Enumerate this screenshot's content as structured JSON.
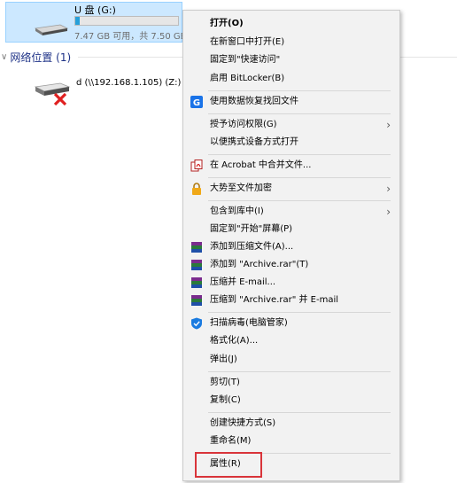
{
  "drive": {
    "name": "U 盘 (G:)",
    "free_text": "7.47 GB 可用，共 7.50 GB",
    "used_fraction": 0.04
  },
  "network_section": {
    "label": "网络位置 (1)"
  },
  "network_drive": {
    "name": "d (\\\\192.168.1.105) (Z:)"
  },
  "menu": {
    "open": "打开(O)",
    "open_new_window": "在新窗口中打开(E)",
    "pin_quick_access": "固定到\"快速访问\"",
    "bitlocker": "启用 BitLocker(B)",
    "data_recovery": "使用数据恢复找回文件",
    "grant_access": "授予访问权限(G)",
    "portable_open": "以便携式设备方式打开",
    "acrobat_merge": "在 Acrobat 中合并文件...",
    "encrypt": "大势至文件加密",
    "include_library": "包含到库中(I)",
    "pin_start": "固定到\"开始\"屏幕(P)",
    "add_archive": "添加到压缩文件(A)...",
    "add_archive_rar": "添加到 \"Archive.rar\"(T)",
    "compress_email": "压缩并 E-mail...",
    "compress_rar_email": "压缩到 \"Archive.rar\" 并 E-mail",
    "scan_virus": "扫描病毒(电脑管家)",
    "format": "格式化(A)...",
    "eject": "弹出(J)",
    "cut": "剪切(T)",
    "copy": "复制(C)",
    "create_shortcut": "创建快捷方式(S)",
    "rename": "重命名(M)",
    "properties": "属性(R)"
  },
  "colors": {
    "highlight_box": "#d9343a",
    "section_header": "#1e3287",
    "selection": "#cce8ff"
  }
}
